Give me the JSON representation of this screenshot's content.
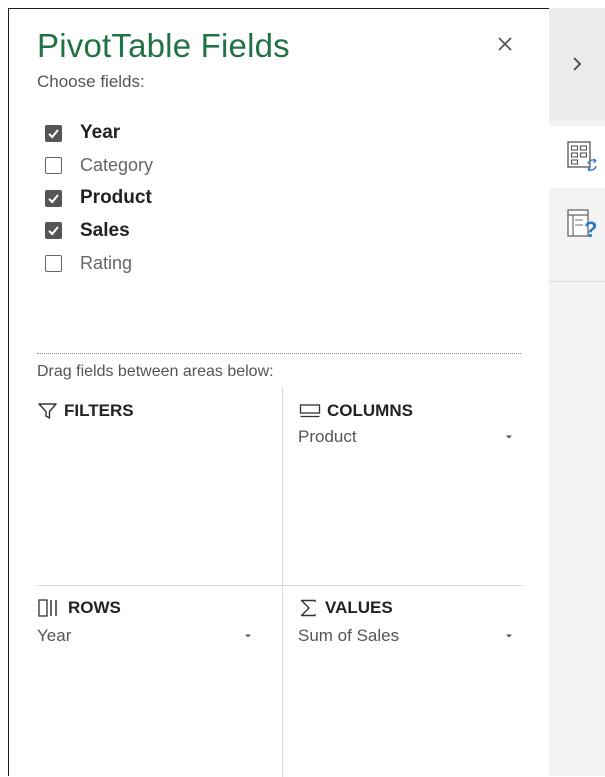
{
  "header": {
    "title": "PivotTable Fields",
    "subtitle": "Choose fields:"
  },
  "fields": [
    {
      "label": "Year",
      "checked": true
    },
    {
      "label": "Category",
      "checked": false
    },
    {
      "label": "Product",
      "checked": true
    },
    {
      "label": "Sales",
      "checked": true
    },
    {
      "label": "Rating",
      "checked": false
    }
  ],
  "areas": {
    "hint": "Drag fields between areas below:",
    "filters": {
      "label": "FILTERS",
      "icon": "filter-icon"
    },
    "columns": {
      "label": "COLUMNS",
      "icon": "columns-icon",
      "item": "Product"
    },
    "rows": {
      "label": "ROWS",
      "icon": "rows-icon",
      "item": "Year"
    },
    "values": {
      "label": "VALUES",
      "icon": "sigma-icon",
      "item": "Sum of Sales"
    }
  },
  "rail": {
    "icons": [
      "chevron-right-icon",
      "field-list-icon",
      "field-list-help-icon"
    ]
  },
  "colors": {
    "accent": "#217346",
    "checkbox_checked": "#555555"
  }
}
